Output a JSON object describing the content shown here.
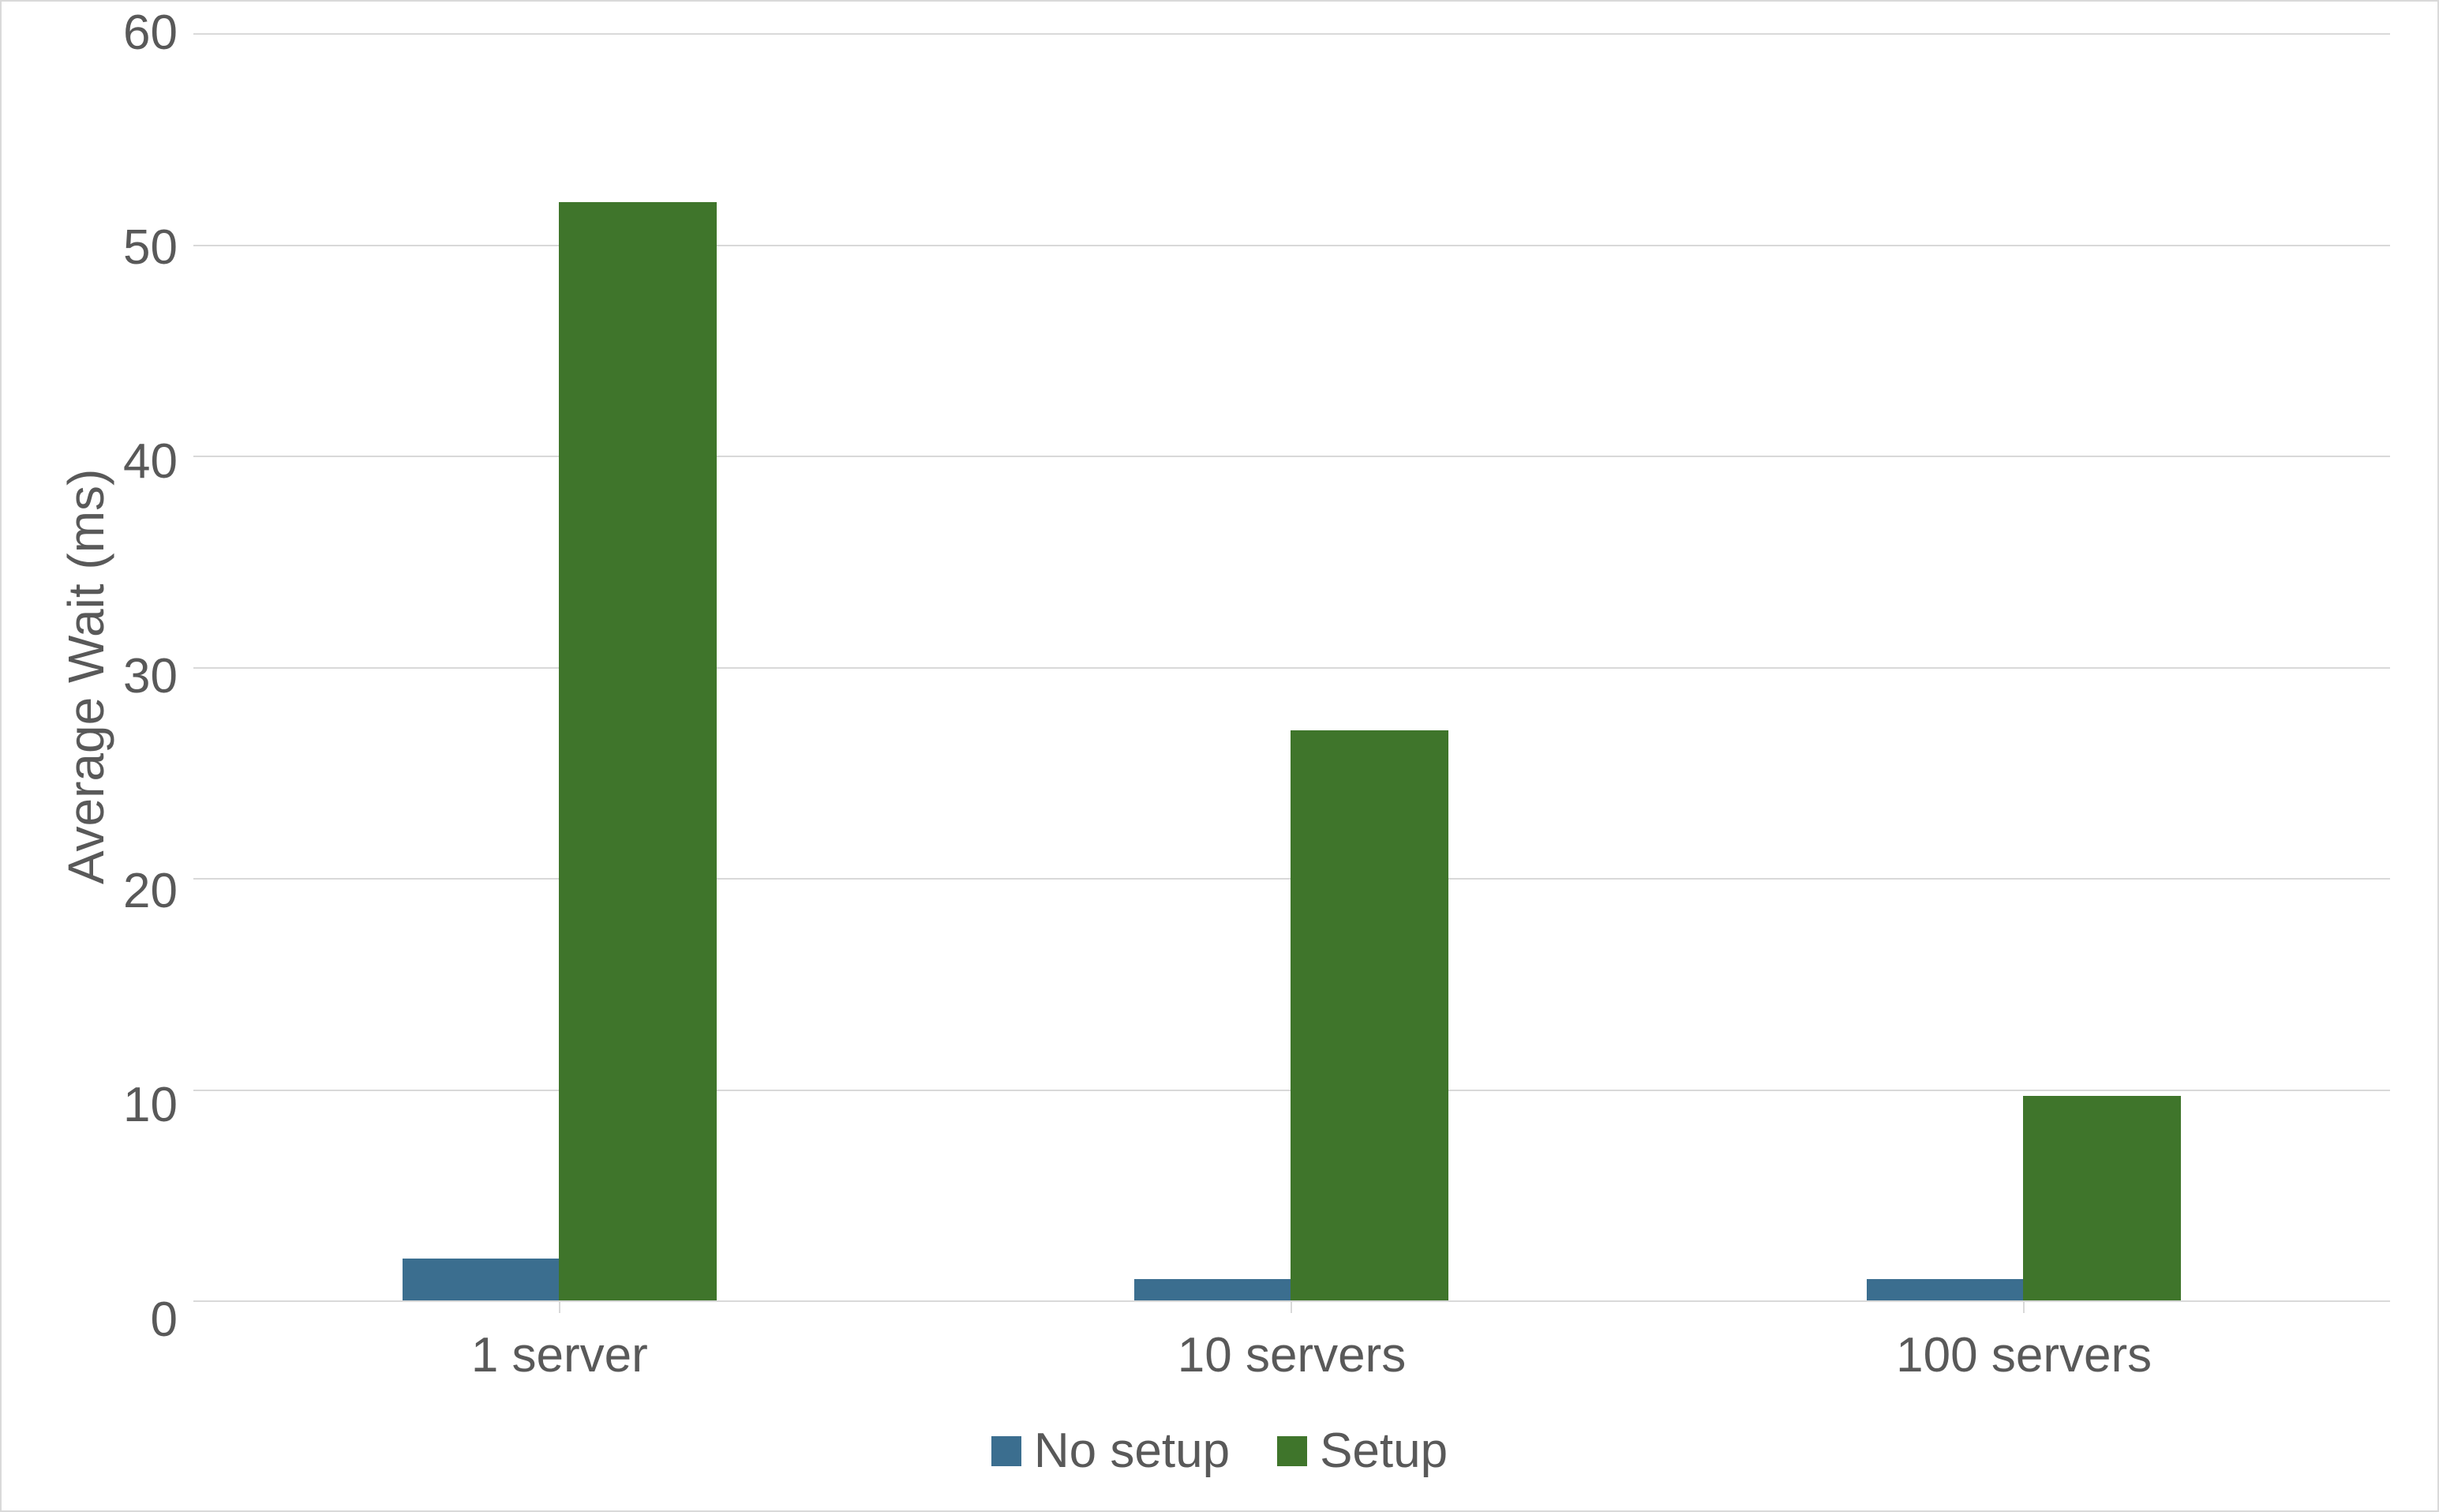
{
  "chart_data": {
    "type": "bar",
    "categories": [
      "1 server",
      "10 servers",
      "100 servers"
    ],
    "series": [
      {
        "name": "No setup",
        "values": [
          2,
          1,
          1
        ],
        "color": "#3b6e8f"
      },
      {
        "name": "Setup",
        "values": [
          52,
          27,
          9.7
        ],
        "color": "#3f752b"
      }
    ],
    "ylabel": "Average Wait (ms)",
    "xlabel": "",
    "ylim": [
      0,
      60
    ],
    "yticks": [
      0,
      10,
      20,
      30,
      40,
      50,
      60
    ],
    "grid": true,
    "legend_position": "bottom"
  },
  "yticks": {
    "t0": "0",
    "t1": "10",
    "t2": "20",
    "t3": "30",
    "t4": "40",
    "t5": "50",
    "t6": "60"
  },
  "xlabels": {
    "c0": "1 server",
    "c1": "10 servers",
    "c2": "100 servers"
  },
  "ylabel": "Average Wait (ms)",
  "legend": {
    "s0": "No setup",
    "s1": "Setup"
  }
}
